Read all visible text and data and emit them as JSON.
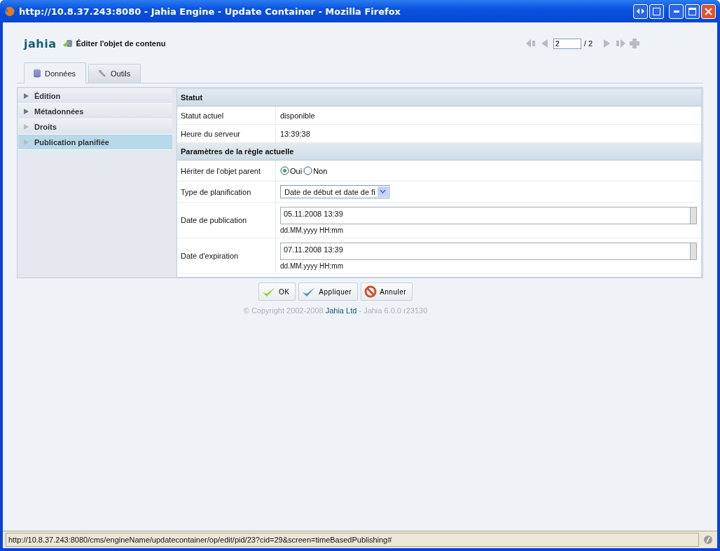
{
  "window": {
    "title": "http://10.8.37.243:8080 - Jahia Engine - Update Container - Mozilla Firefox"
  },
  "header": {
    "logo": "jahia",
    "title": "Éditer l'objet de contenu",
    "pager": {
      "value": "2",
      "total": "/ 2"
    }
  },
  "tabs": [
    {
      "label": "Données",
      "kind": "database",
      "selected": true
    },
    {
      "label": "Outils",
      "kind": "wrench",
      "selected": false
    }
  ],
  "sidebar": {
    "items": [
      {
        "label": "Édition",
        "selected": false
      },
      {
        "label": "Métadonnées",
        "selected": false
      },
      {
        "label": "Droits",
        "selected": false
      },
      {
        "label": "Publication planifiée",
        "selected": true
      }
    ]
  },
  "sections": [
    {
      "title": "Statut",
      "rows": [
        {
          "kind": "text",
          "label": "Statut actuel",
          "value": "disponible"
        },
        {
          "kind": "text",
          "label": "Heure du serveur",
          "value": "13:39:38"
        }
      ]
    },
    {
      "title": "Paramètres de la règle actuelle",
      "rows": [
        {
          "kind": "radio",
          "label": "Hériter de l'objet parent",
          "options": [
            {
              "label": "Oui",
              "selected": true
            },
            {
              "label": "Non",
              "selected": false
            }
          ]
        },
        {
          "kind": "select",
          "label": "Type de planification",
          "value": "Date de début et date de fi"
        },
        {
          "kind": "date",
          "label": "Date de publication",
          "value": "05.11.2008 13:39",
          "hint": "dd.MM.yyyy HH:mm"
        },
        {
          "kind": "date",
          "label": "Date d'expiration",
          "value": "07.11.2008 13:39",
          "hint": "dd.MM.yyyy HH:mm"
        }
      ]
    }
  ],
  "buttons": [
    {
      "label": "OK",
      "kind": "confirm"
    },
    {
      "label": "Appliquer",
      "kind": "apply"
    },
    {
      "label": "Annuler",
      "kind": "cancel"
    }
  ],
  "footer": {
    "copyright": "© Copyright 2002-2008",
    "link": "Jahia Ltd",
    "version": "- Jahia 6.0.0 r23130"
  },
  "status_bar": {
    "url": "http://10.8.37.243:8080/cms/engineName/updatecontainer/op/edit/pid/23?cid=29&screen=timeBasedPublishing#"
  }
}
